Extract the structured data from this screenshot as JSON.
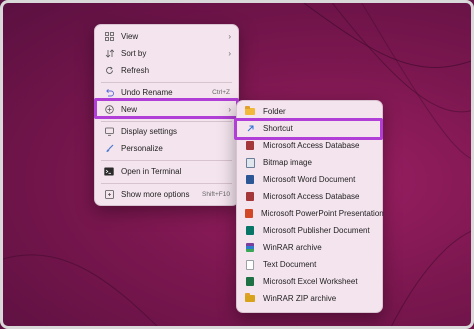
{
  "context_menu": {
    "items": [
      {
        "label": "View",
        "icon": "grid-icon",
        "arrow": "›"
      },
      {
        "label": "Sort by",
        "icon": "sort-icon",
        "arrow": "›"
      },
      {
        "label": "Refresh",
        "icon": "refresh-icon"
      },
      {
        "label": "Undo Rename",
        "icon": "undo-icon",
        "shortcut": "Ctrl+Z"
      },
      {
        "label": "New",
        "icon": "plus-circle-icon",
        "arrow": "›"
      },
      {
        "label": "Display settings",
        "icon": "display-icon"
      },
      {
        "label": "Personalize",
        "icon": "brush-icon"
      },
      {
        "label": "Open in Terminal",
        "icon": "terminal-icon"
      },
      {
        "label": "Show more options",
        "icon": "more-options-icon",
        "shortcut": "Shift+F10"
      }
    ]
  },
  "new_submenu": {
    "items": [
      {
        "label": "Folder",
        "icon": "folder-icon"
      },
      {
        "label": "Shortcut",
        "icon": "shortcut-arrow-icon"
      },
      {
        "label": "Microsoft Access Database",
        "icon": "access-icon",
        "color": "#a4373a"
      },
      {
        "label": "Bitmap image",
        "icon": "bitmap-icon",
        "color": "#6b7f99"
      },
      {
        "label": "Microsoft Word Document",
        "icon": "word-icon",
        "color": "#2b5797"
      },
      {
        "label": "Microsoft Access Database",
        "icon": "access-icon",
        "color": "#a4373a"
      },
      {
        "label": "Microsoft PowerPoint Presentation",
        "icon": "powerpoint-icon",
        "color": "#d24726"
      },
      {
        "label": "Microsoft Publisher Document",
        "icon": "publisher-icon",
        "color": "#077568"
      },
      {
        "label": "WinRAR archive",
        "icon": "winrar-icon",
        "color": "#7a3f9a"
      },
      {
        "label": "Text Document",
        "icon": "text-document-icon",
        "color": "#9aa0a6"
      },
      {
        "label": "Microsoft Excel Worksheet",
        "icon": "excel-icon",
        "color": "#1e7145"
      },
      {
        "label": "WinRAR ZIP archive",
        "icon": "winrar-zip-icon",
        "color": "#d9a21b"
      }
    ]
  },
  "colors": {
    "highlight": "#b13ed6",
    "menu_bg": "#f4e4ee",
    "desktop": "#7c1750"
  }
}
